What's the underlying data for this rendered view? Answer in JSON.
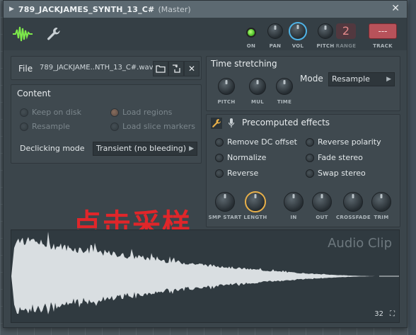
{
  "window": {
    "title": "789_JACKJAMES_SYNTH_13_C#",
    "subtitle": "(Master)",
    "close": "✕"
  },
  "toolbar": {
    "on_label": "ON",
    "pan_label": "PAN",
    "vol_label": "VOL",
    "pitch_label": "PITCH",
    "range_label": "RANGE",
    "range_value": "2",
    "track_label": "TRACK",
    "track_value": "---"
  },
  "file": {
    "label": "File",
    "name": "789_JACKJAME..NTH_13_C#.wav",
    "open_icon": "folder-icon",
    "reload_icon": "reload-icon",
    "remove_icon": "close-icon"
  },
  "content": {
    "title": "Content",
    "options": [
      {
        "label": "Keep on disk",
        "state": "off"
      },
      {
        "label": "Load regions",
        "state": "on"
      },
      {
        "label": "Resample",
        "state": "off"
      },
      {
        "label": "Load slice markers",
        "state": "off"
      }
    ],
    "declicking_label": "Declicking mode",
    "declicking_value": "Transient (no bleeding)"
  },
  "time_stretching": {
    "title": "Time stretching",
    "knobs": [
      "PITCH",
      "MUL",
      "TIME"
    ],
    "mode_label": "Mode",
    "mode_value": "Resample"
  },
  "precomputed": {
    "title": "Precomputed effects",
    "effects": [
      "Remove DC offset",
      "Reverse polarity",
      "Normalize",
      "Fade stereo",
      "Reverse",
      "Swap stereo"
    ],
    "knobs": [
      "SMP START",
      "LENGTH",
      "IN",
      "OUT",
      "CROSSFADE",
      "TRIM"
    ]
  },
  "overlay_text": "点击采样",
  "waveform": {
    "caption": "Audio Clip",
    "zoom": "32"
  },
  "colors": {
    "accent_orange": "#e8b04a",
    "accent_blue": "#4fb3e6",
    "led_green": "#4fc22a",
    "track_red": "#b8525a",
    "watermark_red": "#e0262a"
  }
}
